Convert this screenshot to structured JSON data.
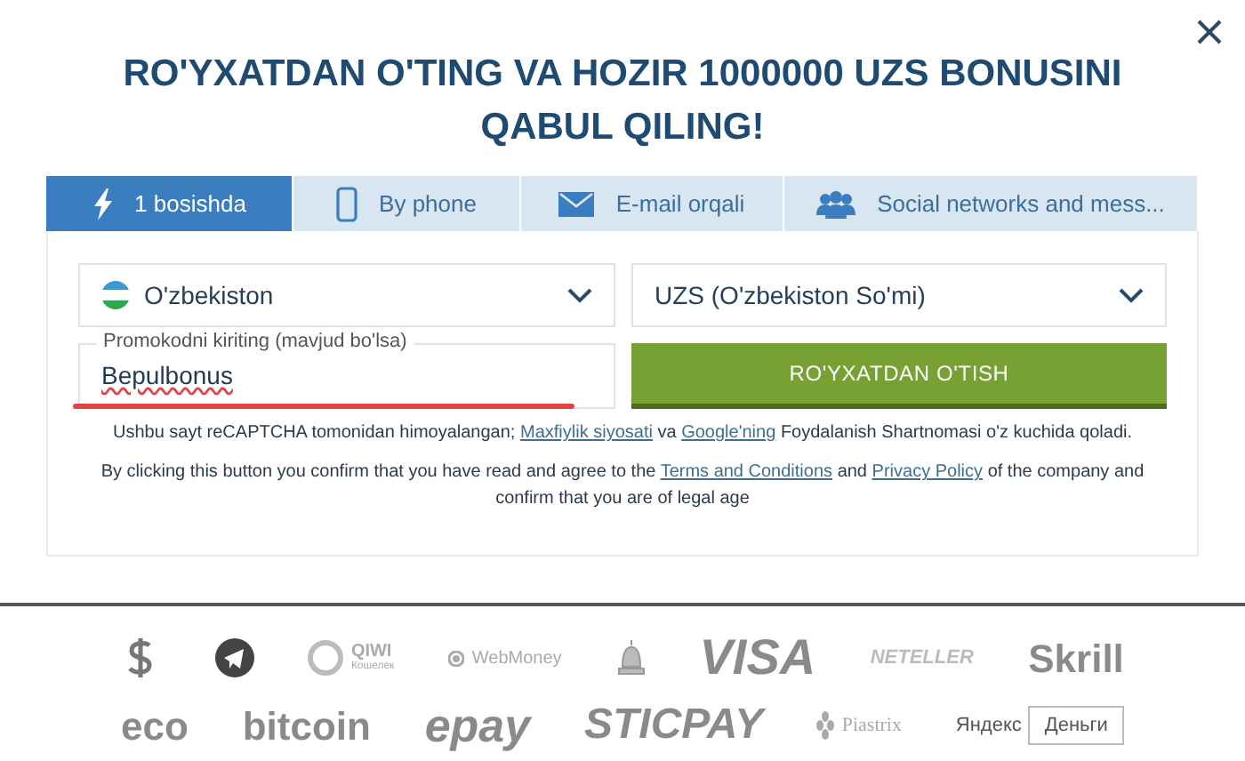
{
  "title": "RO'YXATDAN O'TING VA HOZIR 1000000 UZS BONUSINI QABUL QILING!",
  "tabs": [
    {
      "label": "1 bosishda",
      "kind": "bolt",
      "selected": true
    },
    {
      "label": "By phone",
      "kind": "phone",
      "selected": false
    },
    {
      "label": "E-mail orqali",
      "kind": "mail",
      "selected": false
    },
    {
      "label": "Social networks and mess...",
      "kind": "users",
      "selected": false
    }
  ],
  "country_select": {
    "value": "O'zbekiston"
  },
  "currency_select": {
    "value": "UZS (O'zbekiston So'mi)"
  },
  "promo_field": {
    "label": "Promokodni kiriting (mavjud bo'lsa)",
    "value": "Bepulbonus",
    "underlined": true
  },
  "register_button": "RO'YXATDAN O'TISH",
  "recaptcha_note": {
    "before": "Ushbu sayt reCAPTCHA tomonidan himoyalangan;",
    "link_1": "Maxfiylik siyosati",
    "middle": "va",
    "link_2": "Google'ning",
    "after": "Foydalanish Shartnomasi o'z kuchida qoladi."
  },
  "consent_note": {
    "before": "By clicking this button you confirm that you have read and agree to the",
    "link_1": "Terms and Conditions",
    "middle": "and",
    "link_2": "Privacy Policy",
    "after": "of the company and confirm that you are of legal age"
  },
  "payment_logos": [
    [
      {
        "kind": "dollar"
      },
      {
        "kind": "telegram"
      },
      {
        "kind": "qiwi",
        "text": "QIWI",
        "sub": "Кошелек"
      },
      {
        "kind": "webmoney",
        "text": "WebMoney"
      },
      {
        "kind": "bell"
      },
      {
        "kind": "visa",
        "text": "VISA"
      },
      {
        "kind": "neteller",
        "text": "NETELLER"
      },
      {
        "kind": "skrill",
        "text": "Skrill"
      }
    ],
    [
      {
        "kind": "eco",
        "text": "eco"
      },
      {
        "kind": "bitcoin",
        "text": "bitcoin"
      },
      {
        "kind": "epay",
        "text": "epay"
      },
      {
        "kind": "sticpay",
        "text": "STICPAY"
      },
      {
        "kind": "piastrix",
        "text": "Piastrix"
      },
      {
        "kind": "yandex",
        "text": "Яндекс",
        "sub": "Деньги"
      }
    ]
  ]
}
